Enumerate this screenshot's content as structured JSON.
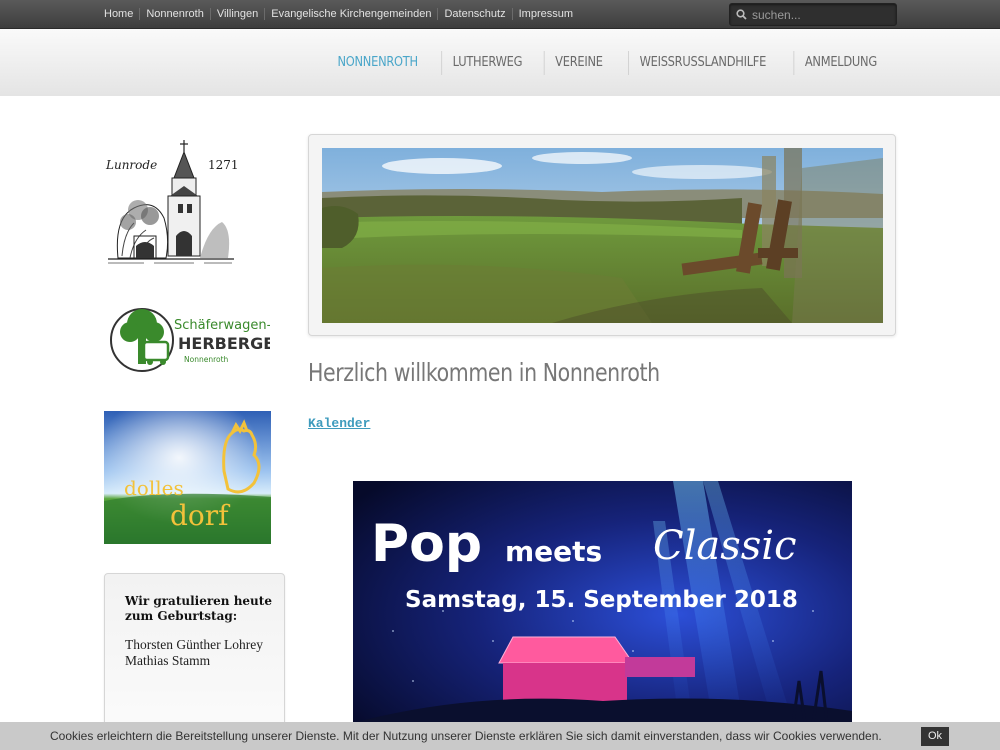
{
  "topnav": {
    "items": [
      "Home",
      "Nonnenroth",
      "Villingen",
      "Evangelische Kirchengemeinden",
      "Datenschutz",
      "Impressum"
    ],
    "search_placeholder": "suchen..."
  },
  "mainnav": {
    "items": [
      "NONNENROTH",
      "LUTHERWEG",
      "VEREINE",
      "WEISSRUSSLANDHILFE",
      "ANMELDUNG"
    ],
    "active_index": 0,
    "active_color": "#4aa6c9"
  },
  "sidebar": {
    "logo1_text_left": "Lunrode",
    "logo1_text_right": "1271",
    "logo2": {
      "line1": "Schäferwagen-",
      "line2": "HERBERGE",
      "line3": "Nonnenroth"
    },
    "logo3": {
      "line1": "dolles",
      "line2": "dorf"
    },
    "birthday": {
      "title": "Wir gratulieren heute zum Geburtstag:",
      "names": [
        "Thorsten Günther Lohrey",
        "Mathias Stamm"
      ]
    }
  },
  "main": {
    "welcome": "Herzlich willkommen in Nonnenroth",
    "calendar_link": "Kalender",
    "poster": {
      "word1": "Pop",
      "word2": "meets",
      "word3": "Classic",
      "date": "Samstag, 15. September 2018"
    }
  },
  "cookie": {
    "message": "Cookies erleichtern die Bereitstellung unserer Dienste. Mit der Nutzung unserer Dienste erklären Sie sich damit einverstanden, dass wir Cookies verwenden.",
    "ok_label": "Ok"
  },
  "colors": {
    "accent": "#4aa6c9",
    "green": "#3a8a2c"
  }
}
